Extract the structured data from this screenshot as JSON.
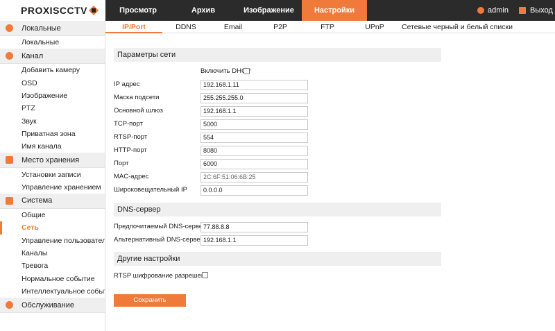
{
  "brand": {
    "logo_text": "PROXISCCTV"
  },
  "topnav": {
    "tabs": [
      "Просмотр",
      "Архив",
      "Изображение",
      "Настройки"
    ],
    "active": "Настройки",
    "user": "admin",
    "logout": "Выход"
  },
  "sidebar": {
    "groups": [
      {
        "label": "Локальные",
        "icon": "gear-icon",
        "items": [
          "Локальные"
        ]
      },
      {
        "label": "Канал",
        "icon": "camera-icon",
        "items": [
          "Добавить камеру",
          "OSD",
          "Изображение",
          "PTZ",
          "Звук",
          "Приватная зона",
          "Имя канала"
        ]
      },
      {
        "label": "Место хранения",
        "icon": "storage-icon",
        "items": [
          "Установки записи",
          "Управление хранением"
        ]
      },
      {
        "label": "Система",
        "icon": "monitor-icon",
        "items": [
          "Общие",
          "Сеть",
          "Управление пользователями",
          "Каналы",
          "Тревога",
          "Нормальное событие",
          "Интеллектуальное событие"
        ]
      },
      {
        "label": "Обслуживание",
        "icon": "info-icon",
        "items": []
      }
    ],
    "active_item": "Сеть"
  },
  "subtabs": [
    "IP/Port",
    "DDNS",
    "Email",
    "P2P",
    "FTP",
    "UPnP",
    "Сетевые черный и белый списки"
  ],
  "active_subtab": "IP/Port",
  "network": {
    "section_title": "Параметры сети",
    "dhcp_label": "Включить DHCP",
    "dhcp_checked": false,
    "fields": [
      {
        "label": "IP адрес",
        "value": "192.168.1.11"
      },
      {
        "label": "Маска подсети",
        "value": "255.255.255.0"
      },
      {
        "label": "Основной шлюз",
        "value": "192.168.1.1"
      },
      {
        "label": "TCP-порт",
        "value": "5000"
      },
      {
        "label": "RTSP-порт",
        "value": "554"
      },
      {
        "label": "HTTP-порт",
        "value": "8080"
      },
      {
        "label": "Порт",
        "value": "6000"
      },
      {
        "label": "MAC-адрес",
        "value": "2C:6F:51:06:6B:25"
      },
      {
        "label": "Широковещательный IP",
        "value": "0.0.0.0"
      }
    ]
  },
  "dns": {
    "section_title": "DNS-сервер",
    "fields": [
      {
        "label": "Предпочитаемый DNS-сервер",
        "value": "77.88.8.8"
      },
      {
        "label": "Альтернативный DNS-сервер",
        "value": "192.168.1.1"
      }
    ]
  },
  "other": {
    "section_title": "Другие настройки",
    "rtsp_label": "RTSP шифрование разрешено",
    "rtsp_checked": false
  },
  "save_label": "Сохранить",
  "colors": {
    "accent": "#f07a3a",
    "topbar": "#2b2b2b"
  }
}
